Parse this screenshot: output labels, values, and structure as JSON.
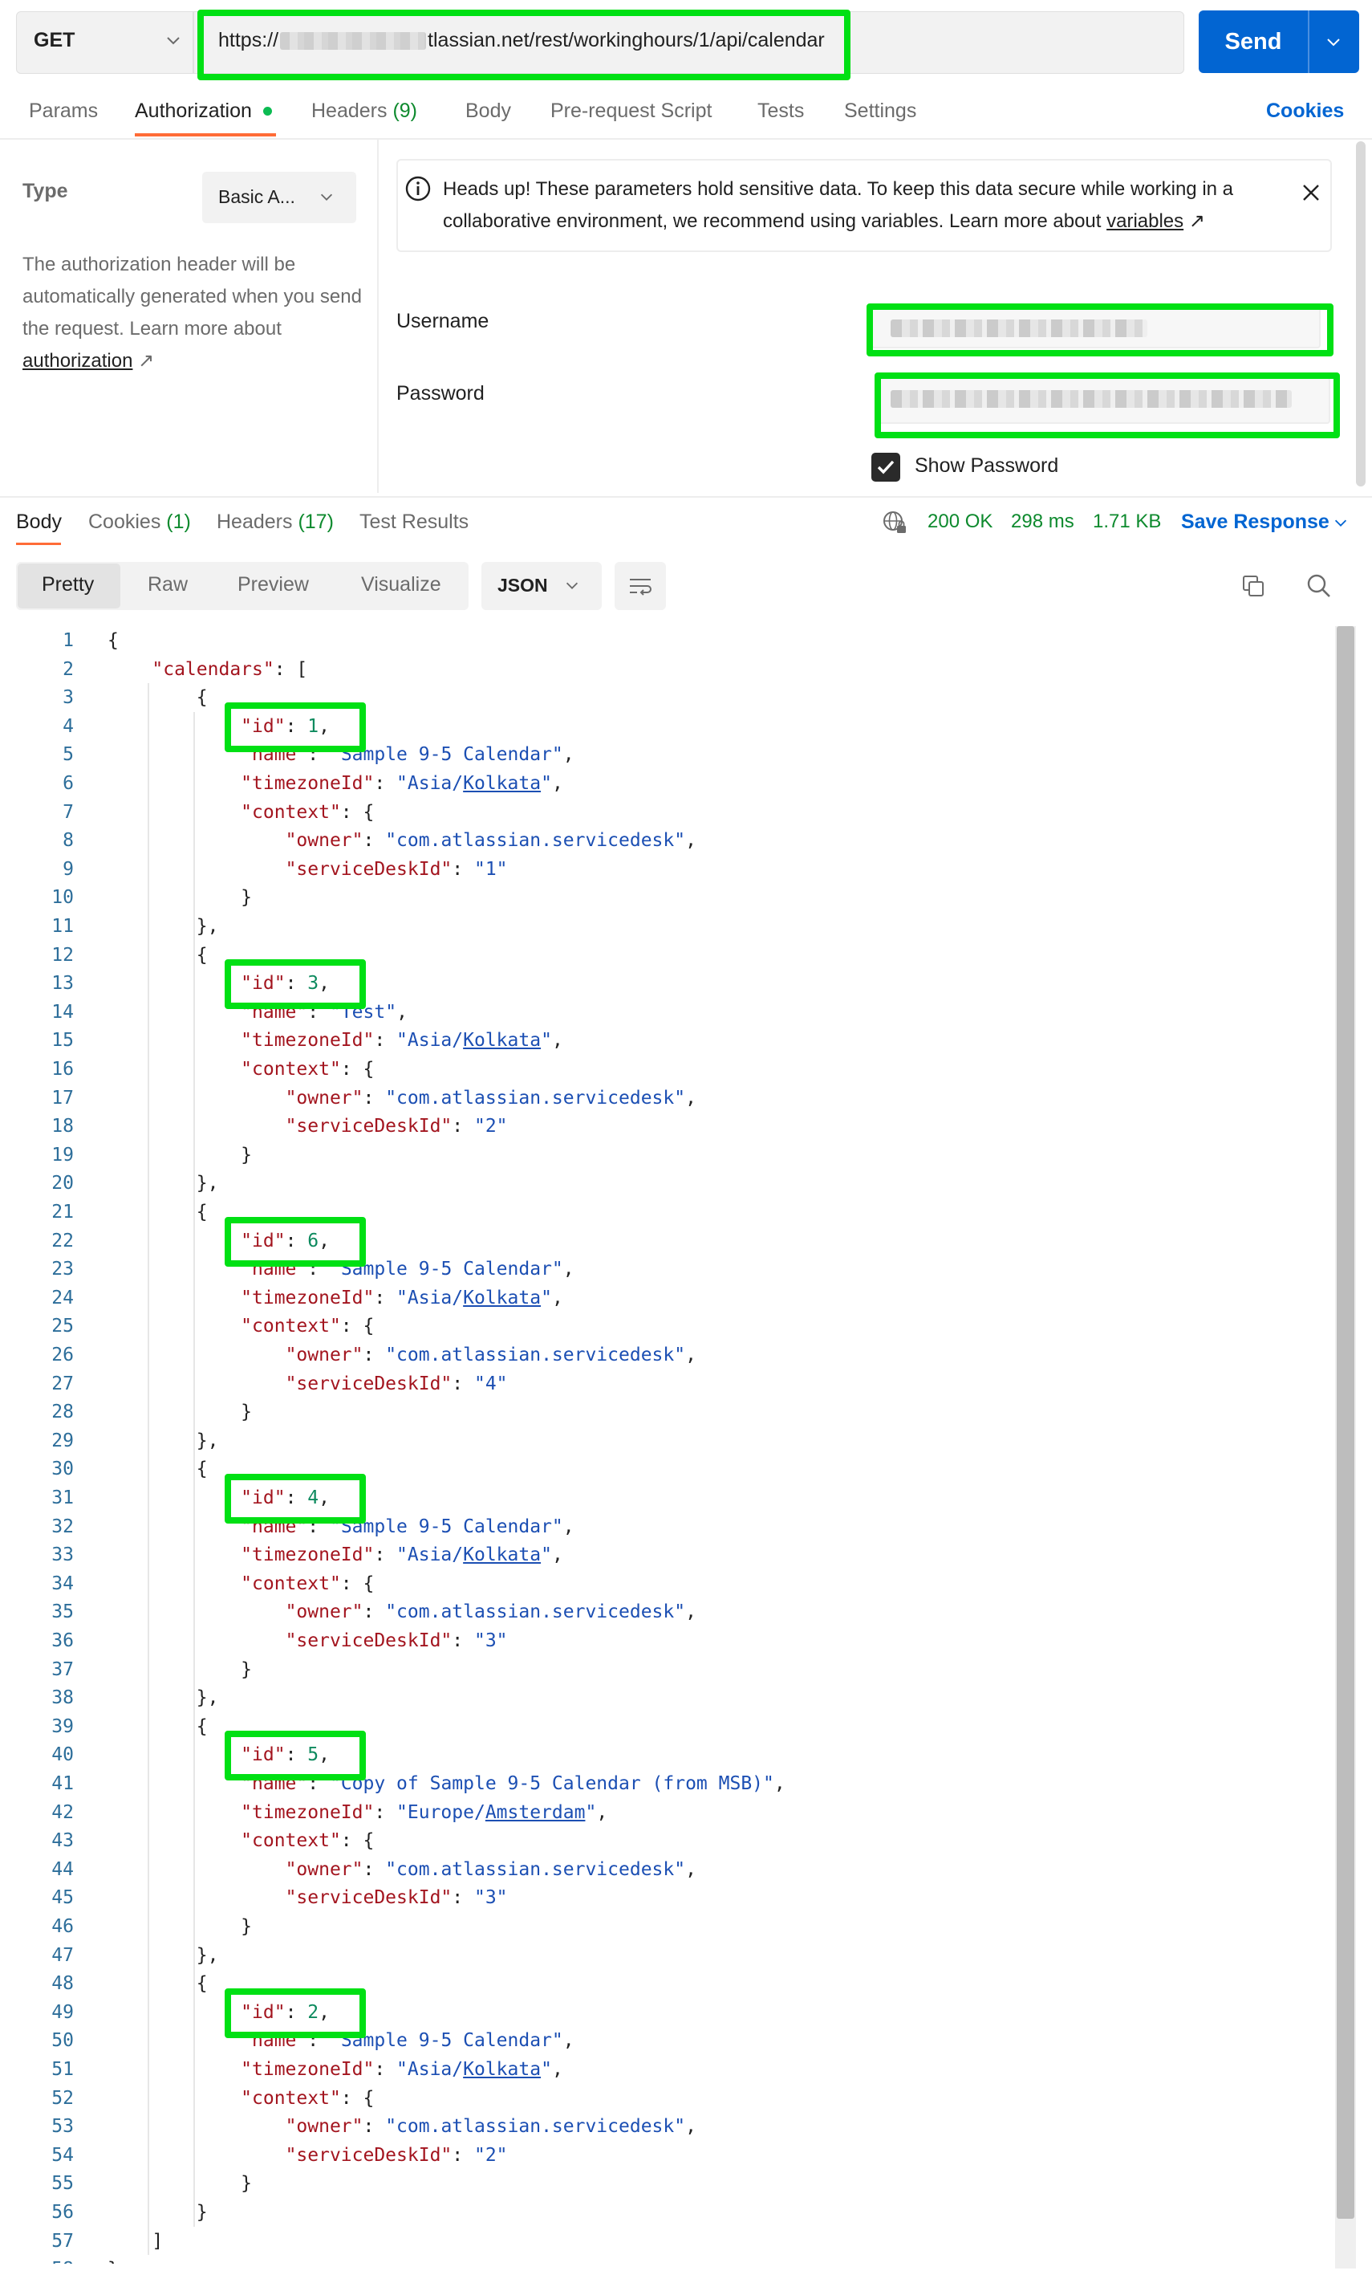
{
  "request": {
    "method": "GET",
    "url_prefix": "https://",
    "url_suffix": "tlassian.net/rest/workinghours/1/api/calendar",
    "send_label": "Send"
  },
  "request_tabs": [
    {
      "label": "Params"
    },
    {
      "label": "Authorization"
    },
    {
      "label": "Headers",
      "count": "(9)"
    },
    {
      "label": "Body"
    },
    {
      "label": "Pre-request Script"
    },
    {
      "label": "Tests"
    },
    {
      "label": "Settings"
    }
  ],
  "cookies_label": "Cookies",
  "auth": {
    "type_label": "Type",
    "type_value": "Basic A...",
    "description": "The authorization header will be automatically generated when you send the request. Learn more about ",
    "description_link": "authorization",
    "link_arrow": "↗",
    "notice": "Heads up! These parameters hold sensitive data. To keep this data secure while working in a collaborative environment, we recommend using variables. Learn more about ",
    "notice_link": "variables",
    "username_label": "Username",
    "password_label": "Password",
    "show_password_label": "Show Password"
  },
  "response_tabs": [
    {
      "label": "Body"
    },
    {
      "label": "Cookies",
      "count": "(1)"
    },
    {
      "label": "Headers",
      "count": "(17)"
    },
    {
      "label": "Test Results"
    }
  ],
  "status": {
    "code": "200 OK",
    "time": "298 ms",
    "size": "1.71 KB"
  },
  "save_response_label": "Save Response",
  "view_modes": [
    "Pretty",
    "Raw",
    "Preview",
    "Visualize"
  ],
  "format": "JSON",
  "calendars": [
    {
      "id": 1,
      "name": "Sample 9-5 Calendar",
      "timezoneId": "Asia/Kolkata",
      "owner": "com.atlassian.servicedesk",
      "serviceDeskId": "1"
    },
    {
      "id": 3,
      "name": "Test",
      "timezoneId": "Asia/Kolkata",
      "owner": "com.atlassian.servicedesk",
      "serviceDeskId": "2"
    },
    {
      "id": 6,
      "name": "Sample 9-5 Calendar",
      "timezoneId": "Asia/Kolkata",
      "owner": "com.atlassian.servicedesk",
      "serviceDeskId": "4"
    },
    {
      "id": 4,
      "name": "Sample 9-5 Calendar",
      "timezoneId": "Asia/Kolkata",
      "owner": "com.atlassian.servicedesk",
      "serviceDeskId": "3"
    },
    {
      "id": 5,
      "name": "Copy of Sample 9-5 Calendar (from MSB)",
      "timezoneId": "Europe/Amsterdam",
      "owner": "com.atlassian.servicedesk",
      "serviceDeskId": "3"
    },
    {
      "id": 2,
      "name": "Sample 9-5 Calendar",
      "timezoneId": "Asia/Kolkata",
      "owner": "com.atlassian.servicedesk",
      "serviceDeskId": "2"
    }
  ],
  "colors": {
    "accent": "#ff6c37",
    "send": "#0265d2",
    "highlight": "#00e014",
    "status_ok": "#0e8a2e",
    "json_key": "#a3151f",
    "json_string": "#1c4fb3",
    "json_number": "#0d8a5e"
  }
}
